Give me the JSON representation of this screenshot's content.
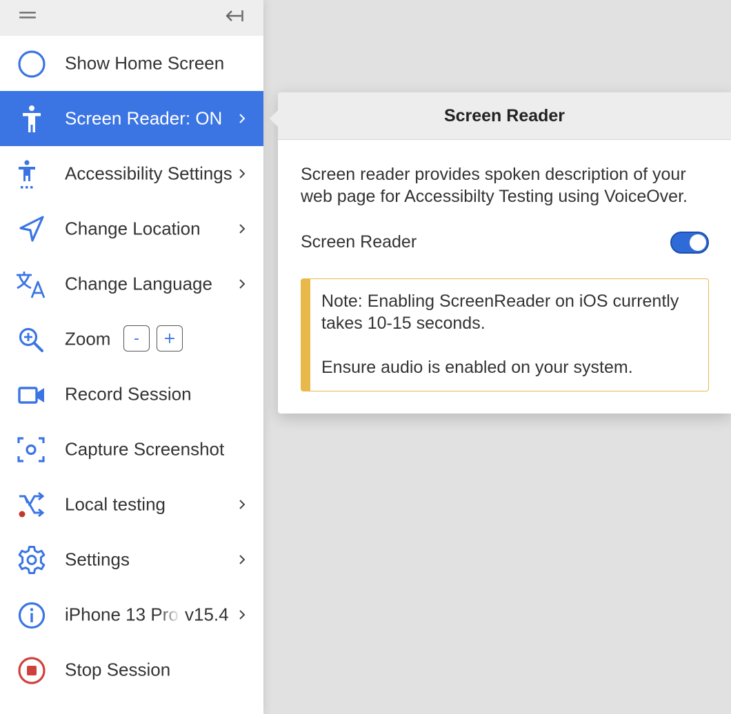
{
  "sidebar": {
    "items": [
      {
        "label": "Show Home Screen",
        "icon": "home-circle-icon",
        "chevron": false,
        "active": false
      },
      {
        "label": "Screen Reader: ON",
        "icon": "accessibility-person-icon",
        "chevron": true,
        "active": true
      },
      {
        "label": "Accessibility Settings",
        "icon": "accessibility-settings-icon",
        "chevron": true,
        "active": false
      },
      {
        "label": "Change Location",
        "icon": "location-arrow-icon",
        "chevron": true,
        "active": false
      },
      {
        "label": "Change Language",
        "icon": "translate-icon",
        "chevron": true,
        "active": false
      },
      {
        "label": "Zoom",
        "icon": "zoom-in-icon",
        "chevron": false,
        "active": false
      },
      {
        "label": "Record Session",
        "icon": "video-camera-icon",
        "chevron": false,
        "active": false
      },
      {
        "label": "Capture Screenshot",
        "icon": "screenshot-icon",
        "chevron": false,
        "active": false
      },
      {
        "label": "Local testing",
        "icon": "local-testing-shuffle-icon",
        "chevron": true,
        "active": false
      },
      {
        "label": "Settings",
        "icon": "gear-icon",
        "chevron": true,
        "active": false
      },
      {
        "label": "iPhone 13 Pro",
        "version": "v15.4",
        "icon": "info-icon",
        "chevron": true,
        "active": false
      },
      {
        "label": "Stop Session",
        "icon": "stop-icon",
        "chevron": false,
        "active": false
      }
    ],
    "zoom": {
      "minus": "-",
      "plus": "+"
    }
  },
  "popover": {
    "title": "Screen Reader",
    "description": "Screen reader provides spoken description of your web page for Accessibilty Testing using VoiceOver.",
    "toggle_label": "Screen Reader",
    "toggle_on": true,
    "note_line1": "Note: Enabling ScreenReader on iOS currently takes 10-15 seconds.",
    "note_line2": "Ensure audio is enabled on your system."
  },
  "colors": {
    "accent": "#3a75e3",
    "stop_red": "#d0413b",
    "note_border": "#e8b84a",
    "local_testing_dot": "#c0392b"
  }
}
